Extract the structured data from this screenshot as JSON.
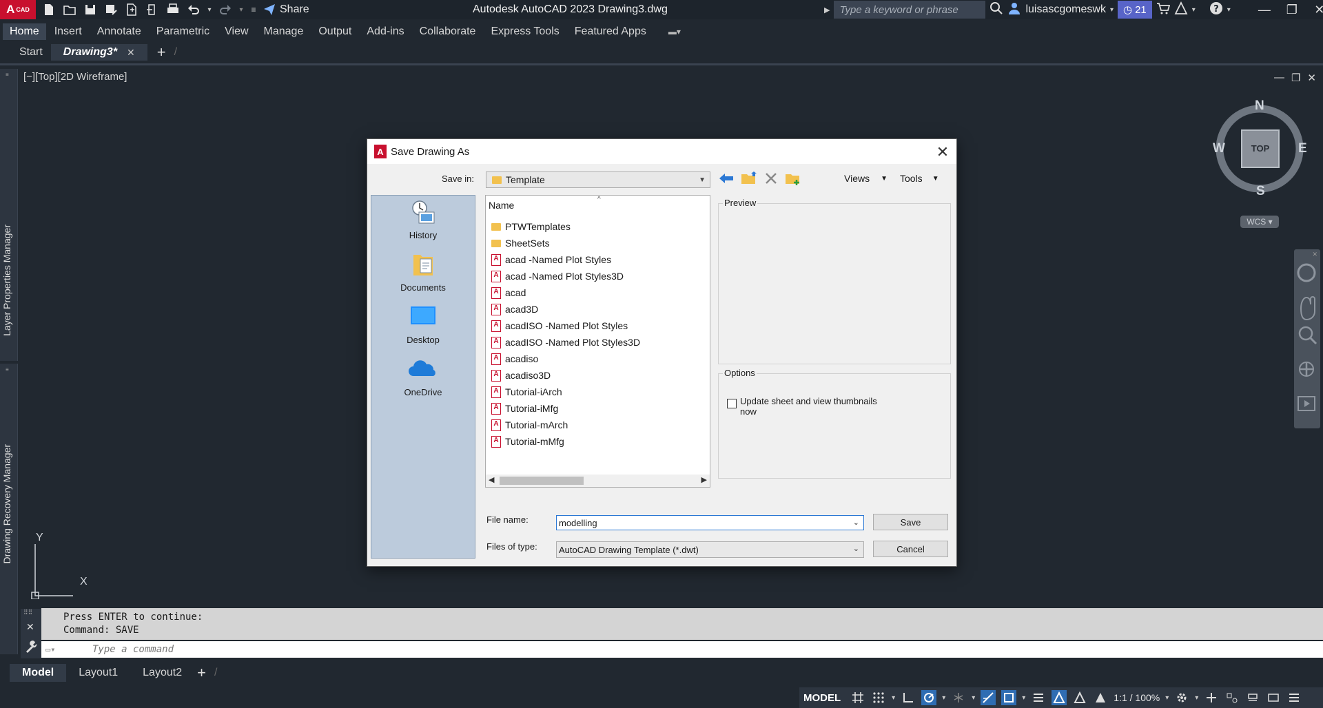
{
  "app": {
    "logo_a": "A",
    "logo_cad": "CAD",
    "title": "Autodesk AutoCAD 2023    Drawing3.dwg",
    "share_label": "Share",
    "search_placeholder": "Type a keyword or phrase",
    "user_name": "luisascgomeswk",
    "trial_count": "21"
  },
  "ribbon": {
    "tabs": [
      "Home",
      "Insert",
      "Annotate",
      "Parametric",
      "View",
      "Manage",
      "Output",
      "Add-ins",
      "Collaborate",
      "Express Tools",
      "Featured Apps"
    ]
  },
  "doc_tabs": {
    "start": "Start",
    "active": "Drawing3*"
  },
  "side_palettes": {
    "top": "Layer Properties Manager",
    "bottom": "Drawing Recovery Manager"
  },
  "viewport": {
    "label": "[−][Top][2D Wireframe]"
  },
  "viewcube": {
    "n": "N",
    "s": "S",
    "e": "E",
    "w": "W",
    "face": "TOP",
    "wcs": "WCS"
  },
  "ucs": {
    "x": "X",
    "y": "Y"
  },
  "dialog": {
    "title": "Save Drawing As",
    "save_in_label": "Save in:",
    "save_in_value": "Template",
    "views_label": "Views",
    "tools_label": "Tools",
    "places": [
      "History",
      "Documents",
      "Desktop",
      "OneDrive"
    ],
    "list_header": "Name",
    "folders": [
      "PTWTemplates",
      "SheetSets"
    ],
    "files": [
      "acad -Named Plot Styles",
      "acad -Named Plot Styles3D",
      "acad",
      "acad3D",
      "acadISO -Named Plot Styles",
      "acadISO -Named Plot Styles3D",
      "acadiso",
      "acadiso3D",
      "Tutorial-iArch",
      "Tutorial-iMfg",
      "Tutorial-mArch",
      "Tutorial-mMfg"
    ],
    "preview_label": "Preview",
    "options_label": "Options",
    "option_text": "Update sheet and view thumbnails now",
    "file_name_label": "File name:",
    "file_name_value": "modelling",
    "file_type_label": "Files of type:",
    "file_type_value": "AutoCAD Drawing Template (*.dwt)",
    "save_button": "Save",
    "cancel_button": "Cancel"
  },
  "command": {
    "line1": "Press ENTER to continue:",
    "line2": "Command: SAVE",
    "placeholder": "Type a command"
  },
  "layout_tabs": [
    "Model",
    "Layout1",
    "Layout2"
  ],
  "status": {
    "model": "MODEL",
    "scale": "1:1 / 100%"
  },
  "colors": {
    "background": "#212830",
    "accent": "#c8102e",
    "active_toggle": "#2f6db3"
  }
}
